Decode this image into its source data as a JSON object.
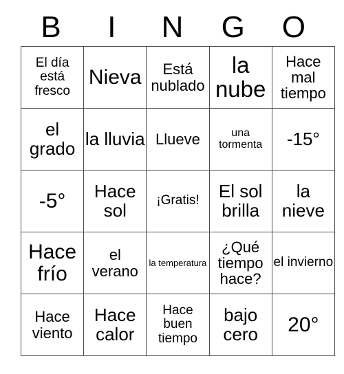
{
  "card": {
    "title_letters": [
      "B",
      "I",
      "N",
      "G",
      "O"
    ],
    "columns": 5,
    "rows": 5,
    "free_space_label": "¡Gratis!",
    "border_color": "#4d4d4d",
    "text_color": "#000000",
    "background_color": "#ffffff",
    "cells": [
      [
        {
          "text": "El día está fresco",
          "size": "fs-sm"
        },
        {
          "text": "Nieva",
          "size": "fs-xl"
        },
        {
          "text": "Está nublado",
          "size": "fs-md"
        },
        {
          "text": "la nube",
          "size": "fs-xxl"
        },
        {
          "text": "Hace mal tiempo",
          "size": "fs-md"
        }
      ],
      [
        {
          "text": "el grado",
          "size": "fs-lg"
        },
        {
          "text": "la lluvia",
          "size": "fs-lg"
        },
        {
          "text": "Llueve",
          "size": "fs-md"
        },
        {
          "text": "una tormenta",
          "size": "fs-xs"
        },
        {
          "text": "-15°",
          "size": "fs-lg"
        }
      ],
      [
        {
          "text": "-5°",
          "size": "fs-xl"
        },
        {
          "text": "Hace sol",
          "size": "fs-lg"
        },
        {
          "text": "¡Gratis!",
          "size": "fs-sm"
        },
        {
          "text": "El sol brilla",
          "size": "fs-lg"
        },
        {
          "text": "la nieve",
          "size": "fs-lg"
        }
      ],
      [
        {
          "text": "Hace frío",
          "size": "fs-xl"
        },
        {
          "text": "el verano",
          "size": "fs-md"
        },
        {
          "text": "la temperatura",
          "size": "fs-xxs"
        },
        {
          "text": "¿Qué tiempo hace?",
          "size": "fs-md"
        },
        {
          "text": "el invierno",
          "size": "fs-sm"
        }
      ],
      [
        {
          "text": "Hace viento",
          "size": "fs-md"
        },
        {
          "text": "Hace calor",
          "size": "fs-lg"
        },
        {
          "text": "Hace buen tiempo",
          "size": "fs-sm"
        },
        {
          "text": "bajo cero",
          "size": "fs-lg"
        },
        {
          "text": "20°",
          "size": "fs-xl"
        }
      ]
    ]
  }
}
